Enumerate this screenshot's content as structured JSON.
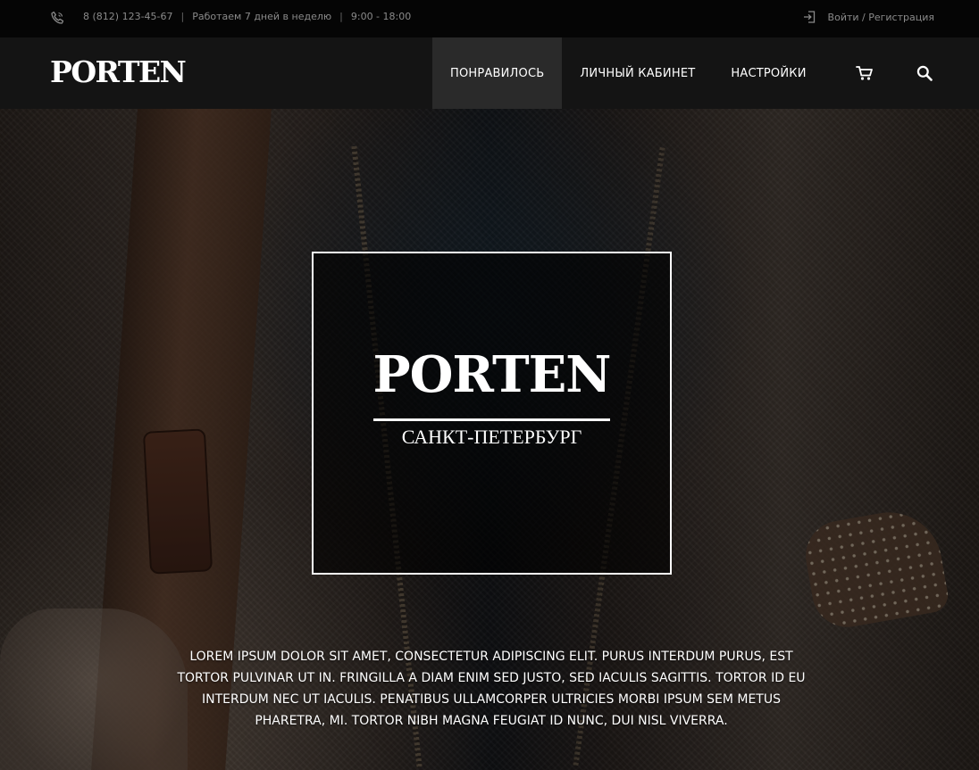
{
  "topbar": {
    "phone": "8 (812) 123-45-67",
    "separator": "|",
    "schedule": "Работаем 7 дней в неделю",
    "hours": "9:00 - 18:00",
    "login": "Войти / Регистрация",
    "icons": {
      "phone": "phone-icon",
      "login": "login-icon"
    }
  },
  "nav": {
    "logo": "PORTEN",
    "menu": [
      {
        "label": "ПОНРАВИЛОСЬ",
        "active": true
      },
      {
        "label": "ЛИЧНЫЙ КАБИНЕТ",
        "active": false
      },
      {
        "label": "НАСТРОЙКИ",
        "active": false
      }
    ],
    "icons": {
      "cart": "cart-icon",
      "search": "search-icon"
    }
  },
  "hero": {
    "title": "PORTEN",
    "subtitle": "САНКТ-ПЕТЕРБУРГ",
    "text": "Lorem ipsum dolor sit amet, consectetur adipiscing elit. Purus interdum purus, est tortor pulvinar ut in. Fringilla a diam enim sed justo, sed iaculis sagittis. Tortor id eu interdum nec ut iaculis. Penatibus ullamcorper ultricies morbi ipsum sem metus pharetra, mi. Tortor nibh magna feugiat id nunc, dui nisl viverra."
  },
  "colors": {
    "topbar_bg": "#050505",
    "nav_bg": "#141414",
    "nav_active_bg": "#2a2a2a",
    "text_light": "#ffffff",
    "text_muted": "#8a8a8a"
  }
}
